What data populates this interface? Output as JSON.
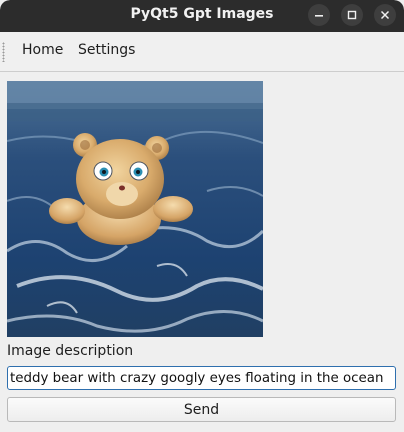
{
  "window": {
    "title": "PyQt5 Gpt Images"
  },
  "menubar": {
    "items": [
      {
        "label": "Home"
      },
      {
        "label": "Settings"
      }
    ]
  },
  "form": {
    "image_description_label": "Image description",
    "description_value": "teddy bear with crazy googly eyes floating in the ocean",
    "send_label": "Send"
  },
  "colors": {
    "titlebar": "#2c2c2c",
    "input_focus_border": "#2e6fae"
  }
}
